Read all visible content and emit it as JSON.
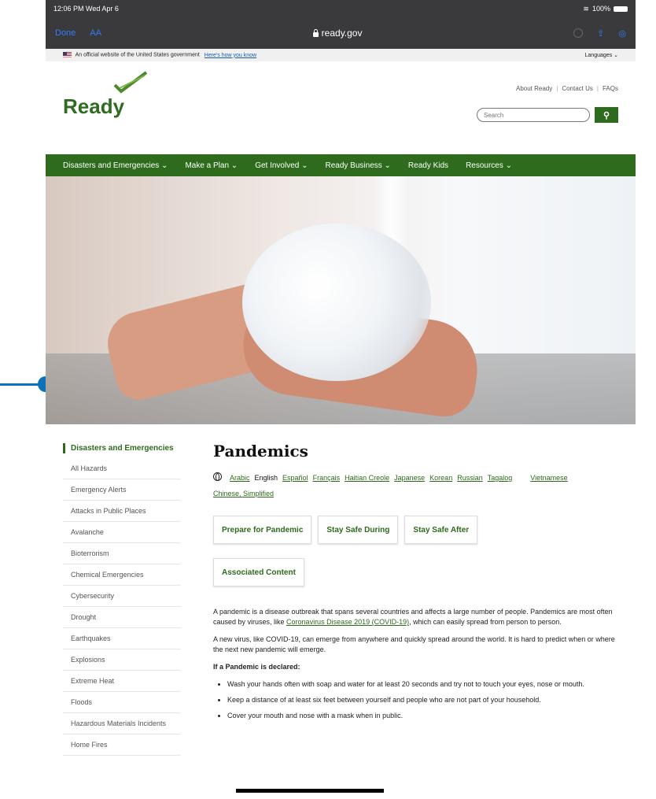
{
  "status": {
    "time": "12:06 PM  Wed Apr 6",
    "battery": "100%"
  },
  "toolbar": {
    "done": "Done",
    "aa": "AA",
    "url": "ready.gov"
  },
  "banner": {
    "text": "An official website of the United States government",
    "link": "Here's how you know",
    "languages": "Languages"
  },
  "header": {
    "logo": "Ready",
    "links": [
      "About Ready",
      "Contact Us",
      "FAQs"
    ],
    "search_placeholder": "Search"
  },
  "nav": [
    "Disasters and Emergencies ⌄",
    "Make a Plan ⌄",
    "Get Involved ⌄",
    "Ready Business ⌄",
    "Ready Kids",
    "Resources ⌄"
  ],
  "sidebar": {
    "title": "Disasters and Emergencies",
    "items": [
      "All Hazards",
      "Emergency Alerts",
      "Attacks in Public Places",
      "Avalanche",
      "Bioterrorism",
      "Chemical Emergencies",
      "Cybersecurity",
      "Drought",
      "Earthquakes",
      "Explosions",
      "Extreme Heat",
      "Floods",
      "Hazardous Materials Incidents",
      "Home Fires"
    ]
  },
  "main": {
    "title": "Pandemics",
    "languages": [
      "Arabic",
      "English",
      "Español",
      "Français",
      "Haitian Creole",
      "Japanese",
      "Korean",
      "Russian",
      "Tagalog",
      "Vietnamese",
      "Chinese, Simplified"
    ],
    "tabs": [
      "Prepare for Pandemic",
      "Stay Safe During",
      "Stay Safe After",
      "Associated Content"
    ],
    "p1_start": "A pandemic is a disease outbreak that spans several countries and affects a large number of people. Pandemics are most often caused by viruses, like ",
    "p1_link": "Coronavirus Disease 2019 (COVID-19)",
    "p1_end": ", which can easily spread from person to person.",
    "p2": "A new virus, like COVID-19, can emerge from anywhere and quickly spread around the world. It is hard to predict when or where the next new pandemic will emerge.",
    "heading": "If a Pandemic is declared:",
    "bullets": [
      "Wash your hands often with soap and water for at least 20 seconds and try not to touch your eyes, nose or mouth.",
      "Keep a distance of at least six feet between yourself and people who are not part of your household.",
      "Cover your mouth and nose with a mask when in public."
    ]
  }
}
